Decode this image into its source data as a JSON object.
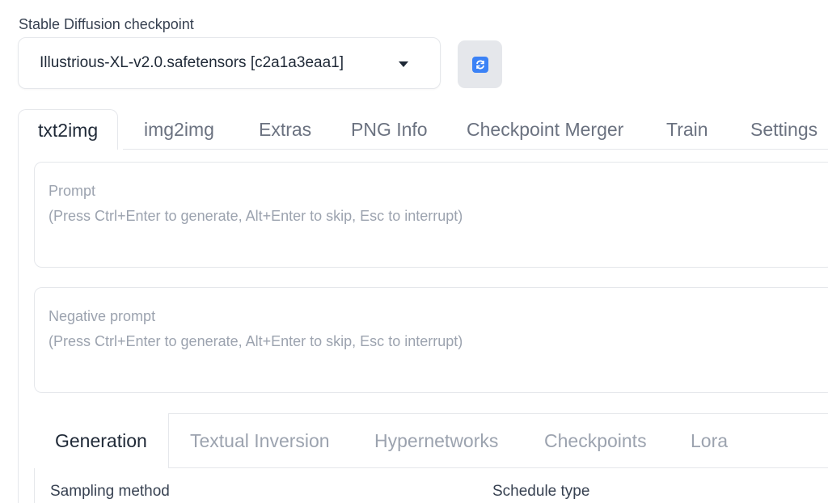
{
  "checkpoint": {
    "label": "Stable Diffusion checkpoint",
    "value": "Illustrious-XL-v2.0.safetensors [c2a1a3eaa1]"
  },
  "main_tabs": [
    {
      "label": "txt2img",
      "active": true
    },
    {
      "label": "img2img",
      "active": false
    },
    {
      "label": "Extras",
      "active": false
    },
    {
      "label": "PNG Info",
      "active": false
    },
    {
      "label": "Checkpoint Merger",
      "active": false
    },
    {
      "label": "Train",
      "active": false
    },
    {
      "label": "Settings",
      "active": false
    }
  ],
  "prompt": {
    "title": "Prompt",
    "hint": "(Press Ctrl+Enter to generate, Alt+Enter to skip, Esc to interrupt)"
  },
  "negative_prompt": {
    "title": "Negative prompt",
    "hint": "(Press Ctrl+Enter to generate, Alt+Enter to skip, Esc to interrupt)"
  },
  "sub_tabs": [
    {
      "label": "Generation",
      "active": true
    },
    {
      "label": "Textual Inversion",
      "active": false
    },
    {
      "label": "Hypernetworks",
      "active": false
    },
    {
      "label": "Checkpoints",
      "active": false
    },
    {
      "label": "Lora",
      "active": false
    }
  ],
  "generation": {
    "sampling_method_label": "Sampling method",
    "schedule_type_label": "Schedule type"
  },
  "colors": {
    "accent": "#3b82f6",
    "border": "#e5e7eb",
    "placeholder": "#9ca3af"
  },
  "icons": {
    "refresh": "refresh-icon",
    "dropdown": "chevron-down-icon"
  }
}
